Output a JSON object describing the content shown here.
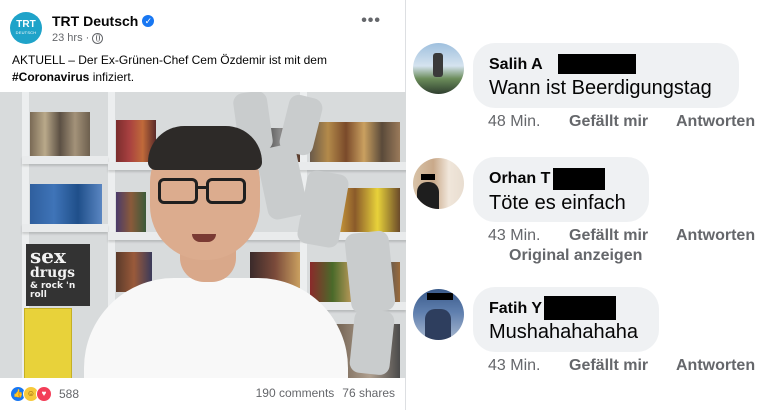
{
  "post": {
    "page_name": "TRT Deutsch",
    "avatar_line1": "TRT",
    "avatar_line2": "DEUTSCH",
    "time": "23 hrs",
    "text_prefix": "AKTUELL – Der Ex-Grünen-Chef Cem Özdemir ist mit dem",
    "hashtag": "#Coronavirus",
    "text_suffix": " infiziert.",
    "poster_line1": "sex",
    "poster_line2": "drugs",
    "poster_line3": "& rock 'n roll",
    "reaction_count": "588",
    "comments_count": "190 comments",
    "shares_count": "76 shares"
  },
  "comments": [
    {
      "name": "Salih A",
      "text": "Wann ist Beerdigungstag",
      "time": "48 Min.",
      "like": "Gefällt mir",
      "reply": "Antworten"
    },
    {
      "name": "Orhan T",
      "text": "Töte es einfach",
      "time": "43 Min.",
      "like": "Gefällt mir",
      "reply": "Antworten",
      "translation": "Original anzeigen"
    },
    {
      "name": "Fatih Y",
      "text": "Mushahahahaha",
      "time": "43 Min.",
      "like": "Gefällt mir",
      "reply": "Antworten"
    }
  ],
  "colors": {
    "accent": "#1877f2",
    "bubble": "#eff1f3",
    "muted": "#65676b",
    "brand": "#1fa3c9"
  }
}
